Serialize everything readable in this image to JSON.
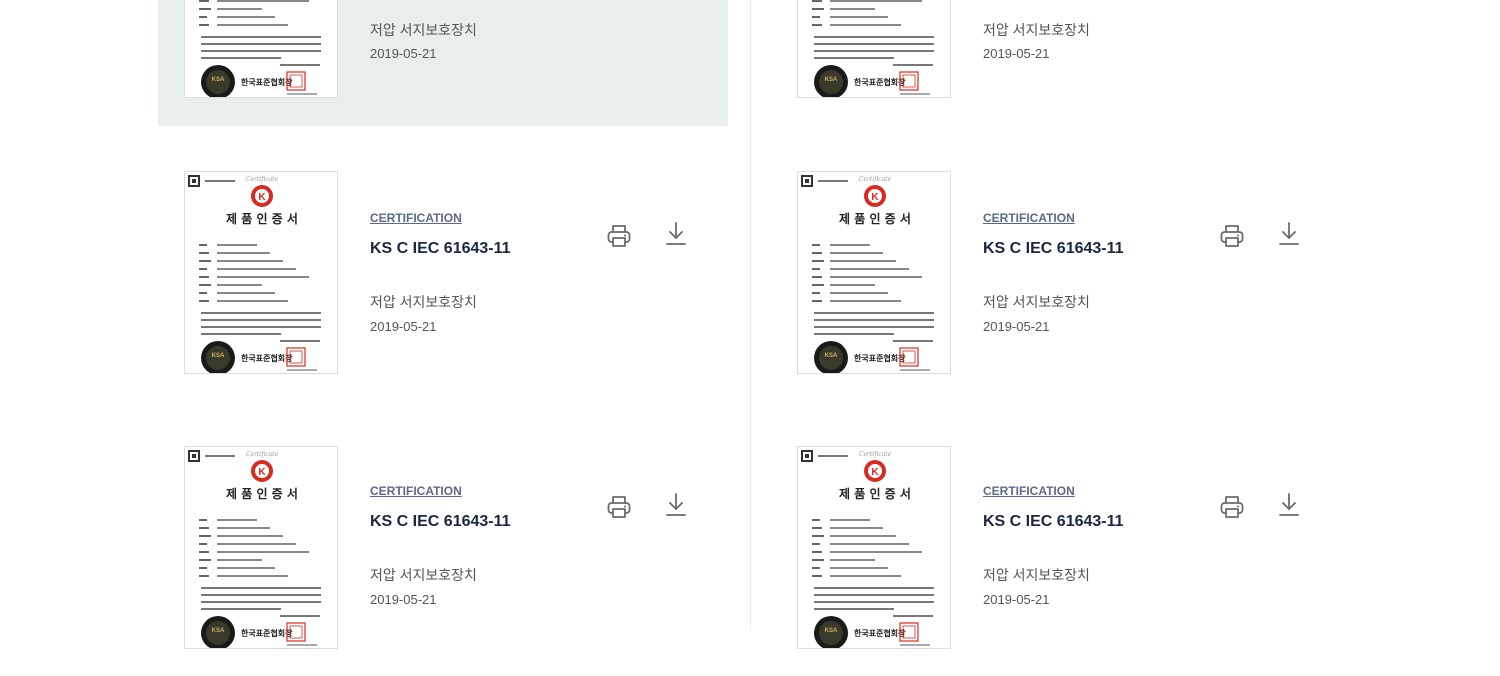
{
  "certificates": [
    {
      "category": "",
      "title": "",
      "description": "저압 서지보호장치",
      "date": "2019-05-21",
      "active": true
    },
    {
      "category": "",
      "title": "",
      "description": "저압 서지보호장치",
      "date": "2019-05-21",
      "active": false
    },
    {
      "category": "CERTIFICATION",
      "title": "KS C IEC 61643-11",
      "description": "저압 서지보호장치",
      "date": "2019-05-21",
      "active": false
    },
    {
      "category": "CERTIFICATION",
      "title": "KS C IEC 61643-11",
      "description": "저압 서지보호장치",
      "date": "2019-05-21",
      "active": false
    },
    {
      "category": "CERTIFICATION",
      "title": "KS C IEC 61643-11",
      "description": "저압 서지보호장치",
      "date": "2019-05-21",
      "active": false
    },
    {
      "category": "CERTIFICATION",
      "title": "KS C IEC 61643-11",
      "description": "저압 서지보호장치",
      "date": "2019-05-21",
      "active": false
    }
  ],
  "certificate_image": {
    "heading": "제 품 인 증 서",
    "issuer": "한국표준협회장",
    "script": "Certificate",
    "ks_mark": "K",
    "seal_text": "KSA"
  },
  "icons": {
    "print": "printer-icon",
    "download": "download-icon"
  },
  "colors": {
    "accent_blue": "#5b6b86",
    "title_navy": "#1a2744",
    "active_bg": "#e8eded",
    "ks_red": "#d62b1f"
  }
}
